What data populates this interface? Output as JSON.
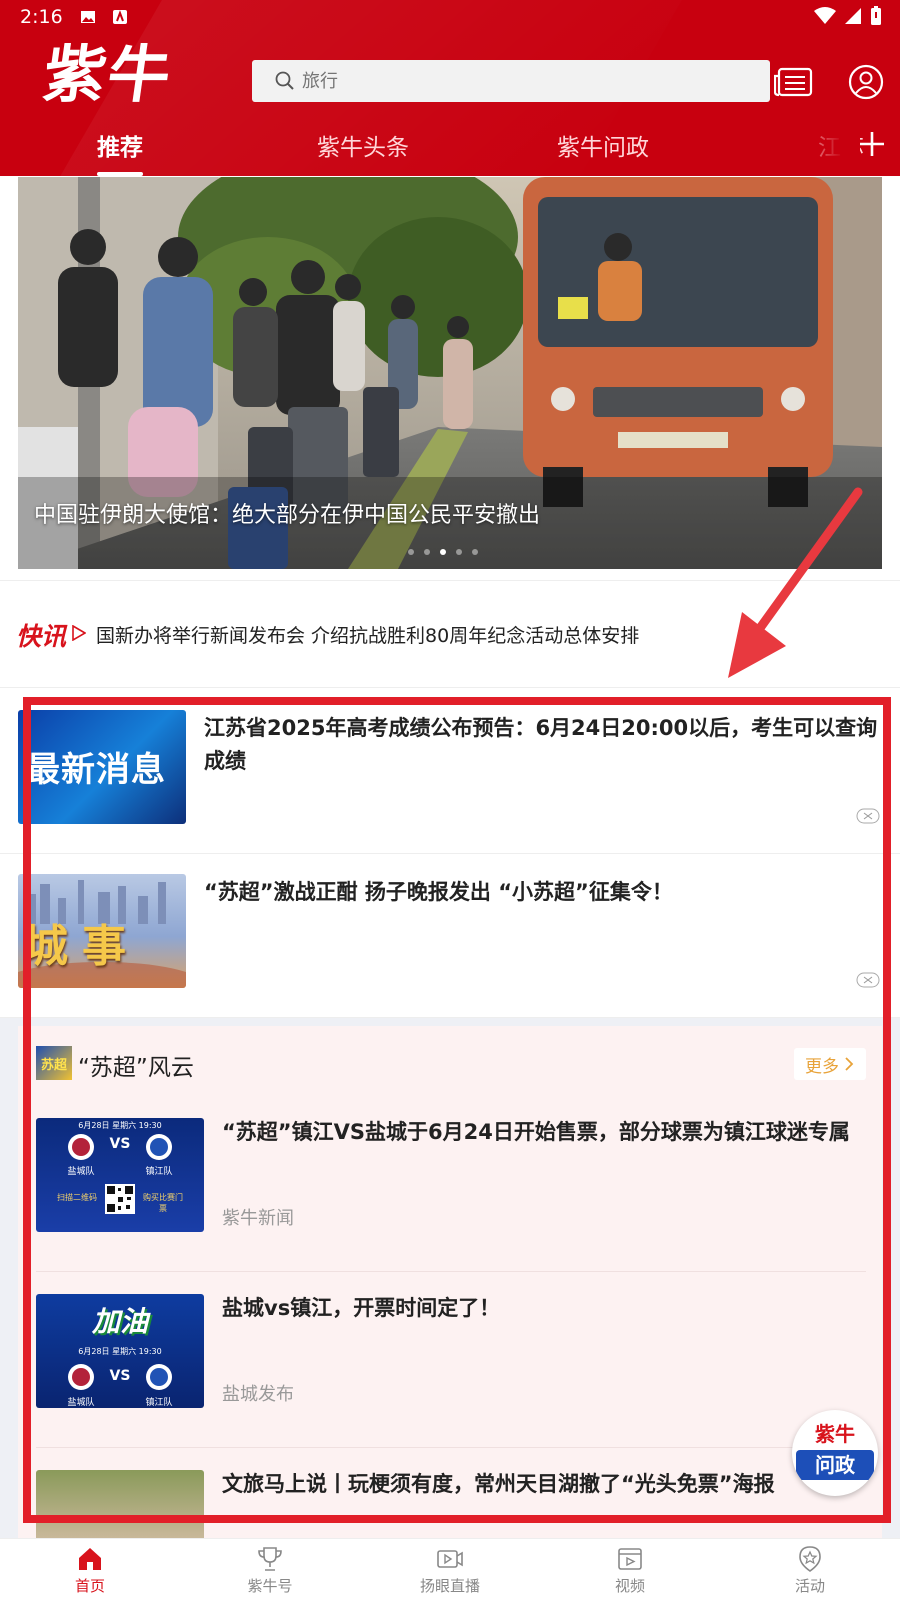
{
  "status_bar": {
    "time": "2:16"
  },
  "header": {
    "logo": "紫牛",
    "search_placeholder": "旅行",
    "tabs": [
      "推荐",
      "紫牛头条",
      "紫牛问政",
      "江苏"
    ]
  },
  "banner": {
    "caption": "中国驻伊朗大使馆：绝大部分在伊中国公民平安撤出"
  },
  "flash": {
    "label": "快讯",
    "text": "国新办将举行新闻发布会 介绍抗战胜利80周年纪念活动总体安排"
  },
  "news": [
    {
      "thumb_text": "最新消息",
      "title": "江苏省2025年高考成绩公布预告：6月24日20:00以后，考生可以查询成绩"
    },
    {
      "thumb_text": "城事",
      "title": "“苏超”激战正酣 扬子晚报发出 “小苏超”征集令！"
    }
  ],
  "topic": {
    "logo_text": "苏超",
    "title": "“苏超”风云",
    "more": "更多",
    "items": [
      {
        "title": "“苏超”镇江VS盐城于6月24日开始售票，部分球票为镇江球迷专属",
        "source": "紫牛新闻",
        "thumb": {
          "date": "6月28日 星期六 19:30",
          "vs": "VS",
          "left_team": "盐城队",
          "right_team": "镇江队",
          "scan": "扫描二维码",
          "buy": "购买比赛门票"
        }
      },
      {
        "title": "盐城vs镇江，开票时间定了！",
        "source": "盐城发布",
        "thumb": {
          "banner": "加油",
          "date": "6月28日 星期六 19:30",
          "vs": "VS",
          "left_team": "盐城队",
          "right_team": "镇江队"
        }
      },
      {
        "title": "文旅马上说丨玩梗须有度，常州天目湖撤了“光头免票”海报",
        "source": "",
        "thumb": {}
      }
    ]
  },
  "float_button": {
    "top": "紫牛",
    "bottom": "问政"
  },
  "bottom_nav": [
    {
      "label": "首页",
      "icon": "home-icon",
      "active": true
    },
    {
      "label": "紫牛号",
      "icon": "trophy-icon",
      "active": false
    },
    {
      "label": "扬眼直播",
      "icon": "live-video-icon",
      "active": false
    },
    {
      "label": "视频",
      "icon": "video-icon",
      "active": false
    },
    {
      "label": "活动",
      "icon": "activity-badge-icon",
      "active": false
    }
  ],
  "colors": {
    "brand_red": "#c8000f",
    "accent_red": "#d8131c",
    "more_orange": "#e8a33a",
    "topic_bg": "#fdf2f2"
  }
}
